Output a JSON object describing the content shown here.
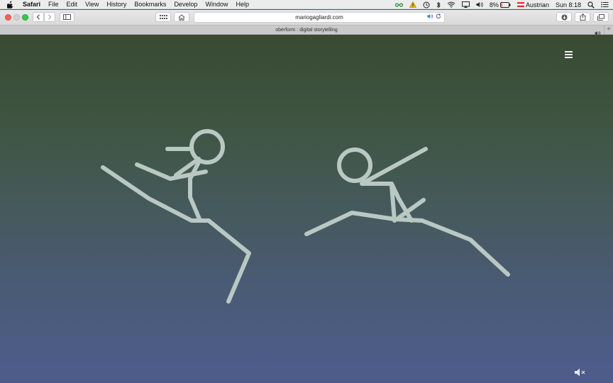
{
  "menubar": {
    "app_name": "Safari",
    "items": [
      "File",
      "Edit",
      "View",
      "History",
      "Bookmarks",
      "Develop",
      "Window",
      "Help"
    ],
    "battery": "8%",
    "input_source": "Austrian",
    "clock": "Sun 8:18"
  },
  "toolbar": {
    "url": "mariogagliardi.com"
  },
  "tab": {
    "title": "oberform : digital storytelling"
  },
  "colors": {
    "figure_stroke": "#b9c8c3",
    "bg_top": "#384a32",
    "bg_bottom": "#4e5c8c"
  },
  "icons": [
    "apple-icon",
    "hamburger-menu-icon",
    "mute-icon",
    "speaker-icon",
    "reload-icon",
    "home-icon",
    "sidebar-icon",
    "downloads-icon",
    "share-icon",
    "tabs-overview-icon"
  ]
}
